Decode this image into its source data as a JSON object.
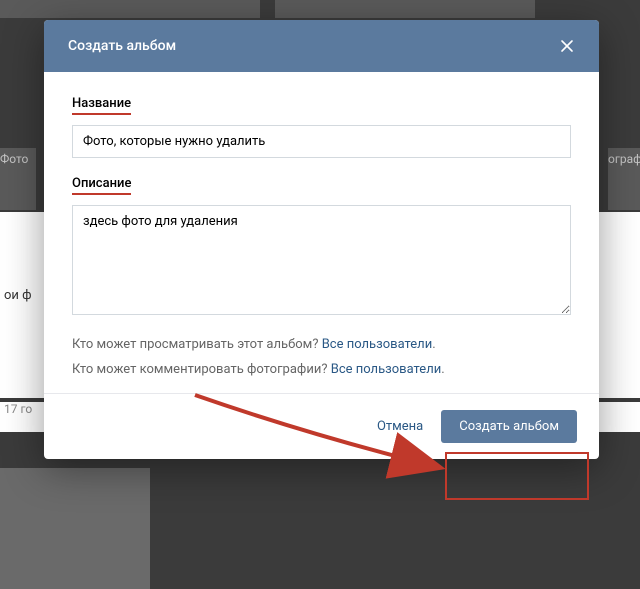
{
  "modal": {
    "title": "Создать альбом",
    "name_label": "Название",
    "name_value": "Фото, которые нужно удалить",
    "desc_label": "Описание",
    "desc_value": "здесь фото для удаления",
    "privacy_view_q": "Кто может просматривать этот альбом? ",
    "privacy_view_a": "Все пользователи",
    "privacy_comment_q": "Кто может комментировать фотографии? ",
    "privacy_comment_a": "Все пользователи",
    "dot": ".",
    "cancel": "Отмена",
    "submit": "Создать альбом"
  },
  "background": {
    "left_label": "Фото",
    "right_label": "ограф",
    "mid1": "ои ф",
    "mid2": "17 го"
  },
  "colors": {
    "header_bg": "#5b7a9e",
    "link": "#2a5885",
    "highlight": "#c0392b"
  }
}
